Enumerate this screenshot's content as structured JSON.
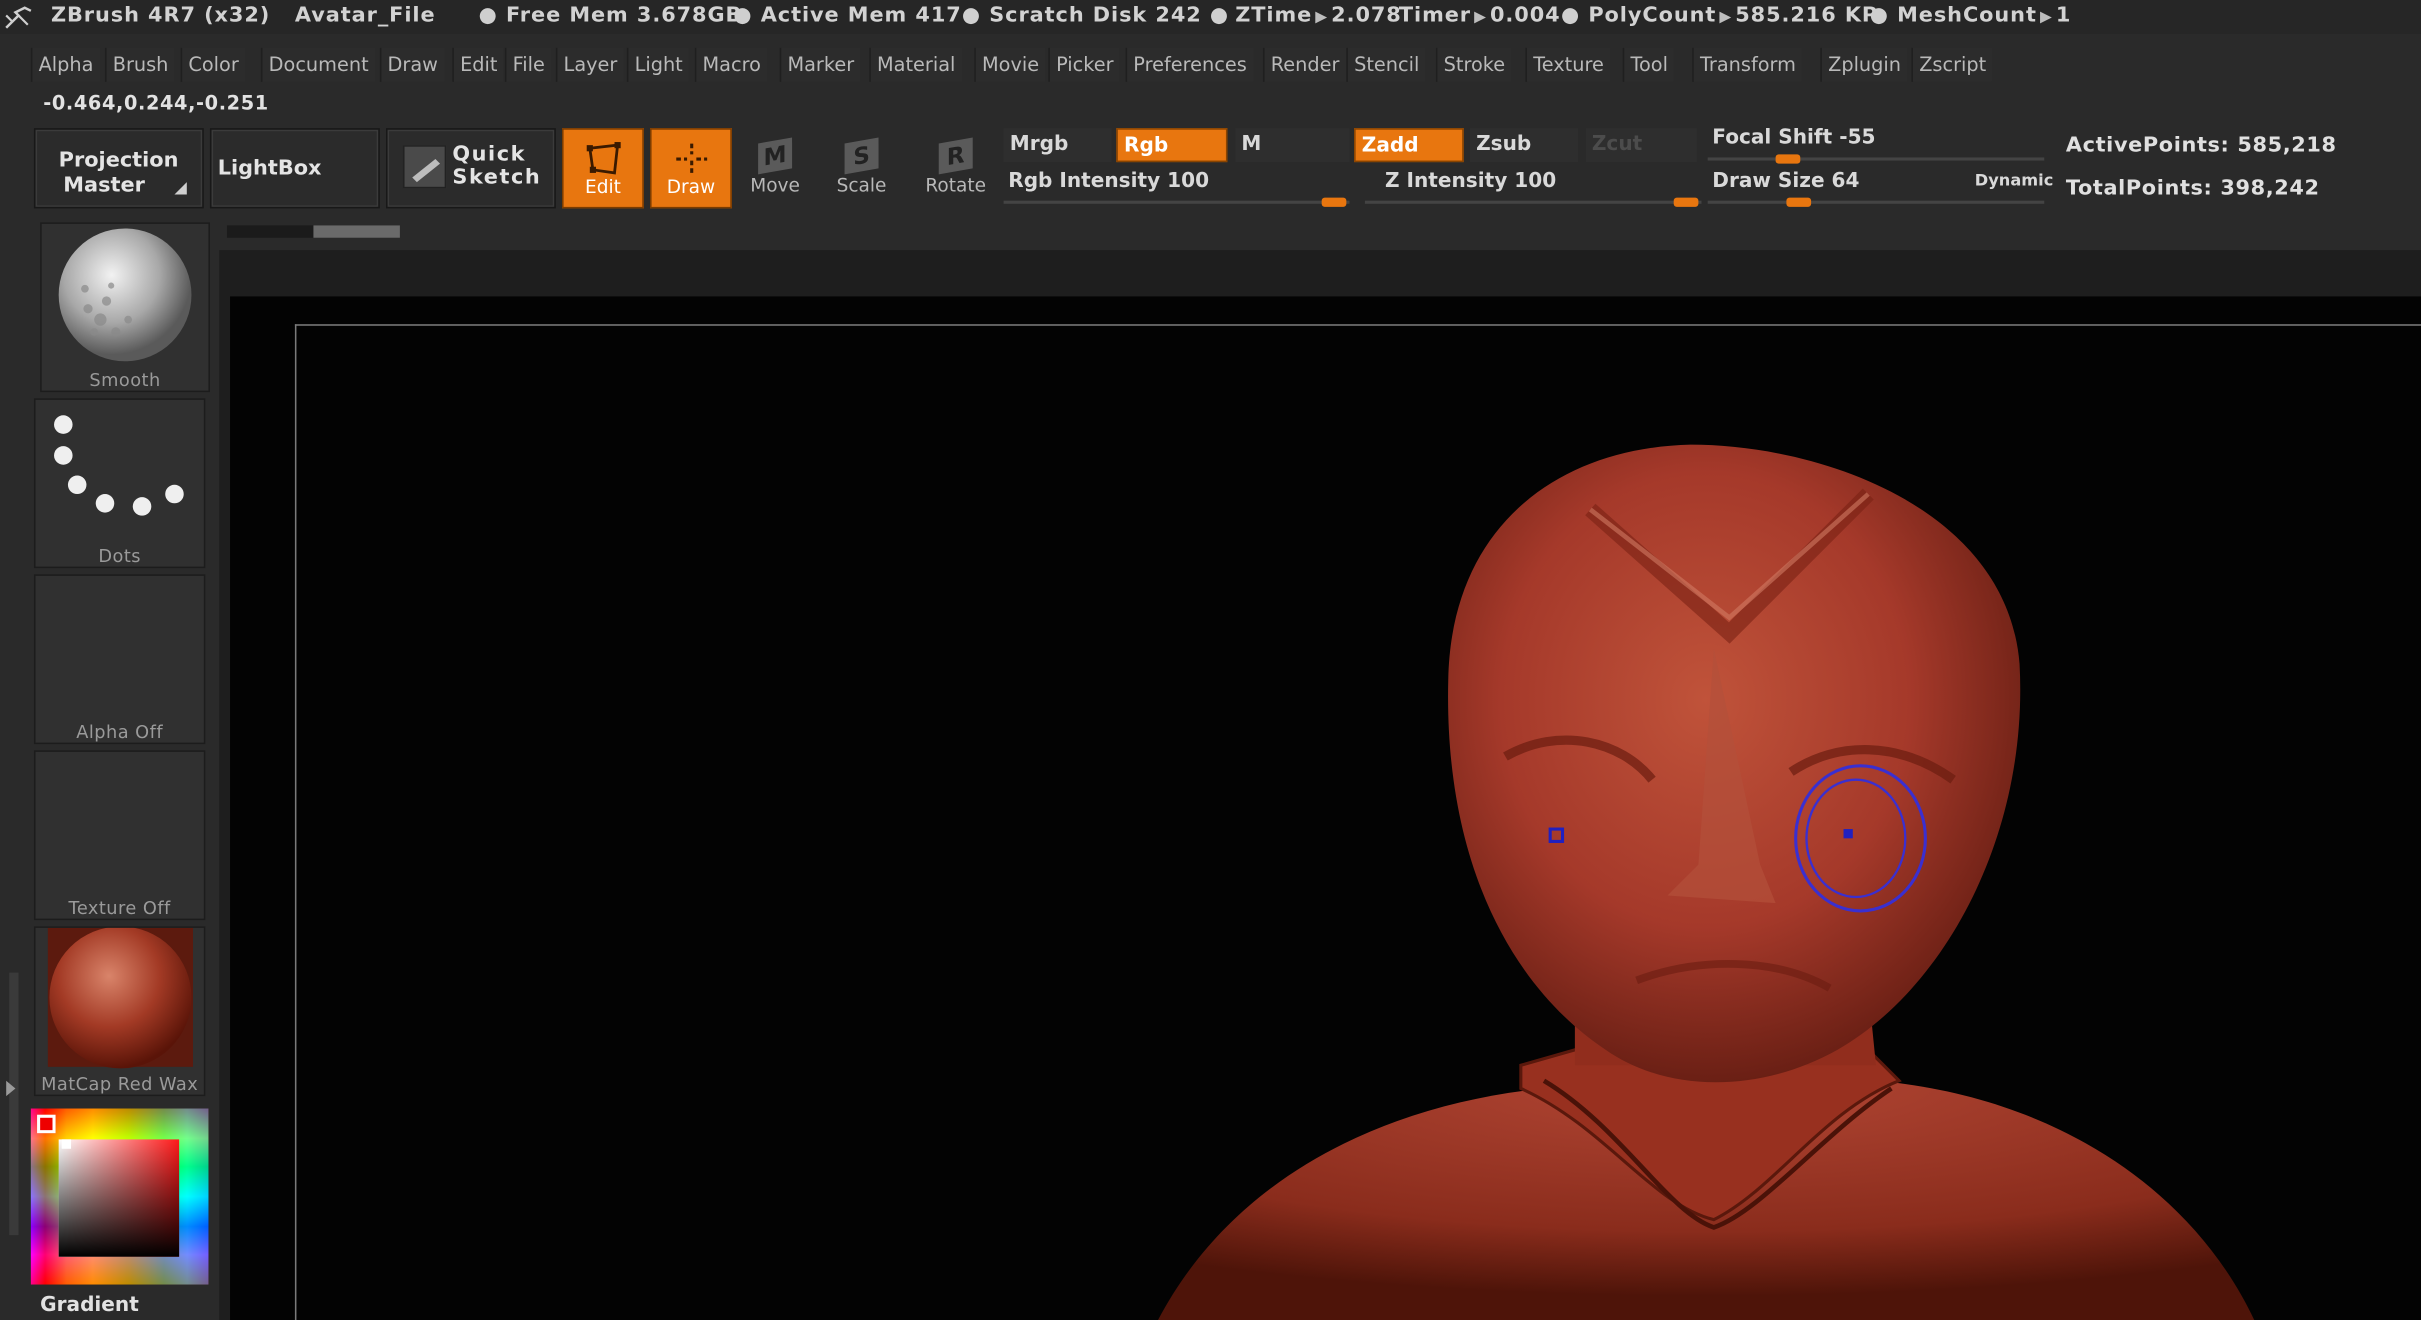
{
  "title_bar": {
    "app_name": "ZBrush 4R7 (x32)",
    "document_name": "Avatar_File",
    "free_mem_label": "Free Mem",
    "free_mem_value": "3.678GB",
    "active_mem_label": "Active Mem",
    "active_mem_value": "417",
    "scratch_disk_label": "Scratch Disk",
    "scratch_disk_value": "242",
    "ztime_label": "ZTime",
    "ztime_value": "2.078",
    "timer_label": "Timer",
    "timer_value": "0.004",
    "polycount_label": "PolyCount",
    "polycount_value": "585.216 KP",
    "meshcount_label": "MeshCount",
    "meshcount_value": "1",
    "logo_icon": "zbrush-logo-icon"
  },
  "menu": {
    "items": [
      "Alpha",
      "Brush",
      "Color",
      "Document",
      "Draw",
      "Edit",
      "File",
      "Layer",
      "Light",
      "Macro",
      "Marker",
      "Material",
      "Movie",
      "Picker",
      "Preferences",
      "Render",
      "Stencil",
      "Stroke",
      "Texture",
      "Tool",
      "Transform",
      "Zplugin",
      "Zscript"
    ]
  },
  "coordinates": "-0.464,0.244,-0.251",
  "shelf": {
    "projection_master_line1": "Projection",
    "projection_master_line2": "Master",
    "lightbox": "LightBox",
    "quick_sketch_line1": "Quick",
    "quick_sketch_line2": "Sketch",
    "edit": "Edit",
    "draw": "Draw",
    "move": "Move",
    "scale": "Scale",
    "rotate": "Rotate",
    "move_glyph": "M",
    "scale_glyph": "S",
    "rotate_glyph": "R",
    "mrgb": "Mrgb",
    "rgb": "Rgb",
    "m": "M",
    "zadd": "Zadd",
    "zsub": "Zsub",
    "zcut": "Zcut",
    "rgb_intensity_label": "Rgb  Intensity 100",
    "rgb_intensity_level": 100,
    "z_intensity_label": "Z  Intensity 100",
    "z_intensity_level": 100,
    "focal_shift_label": "Focal  Shift -55",
    "focal_shift_value": -55,
    "draw_size_label": "Draw  Size 64",
    "draw_size_value": 64,
    "dynamic": "Dynamic",
    "active_points": "ActivePoints: 585,218",
    "total_points": "TotalPoints: 398,242"
  },
  "left_tray": {
    "brush": "Smooth",
    "stroke": "Dots",
    "alpha": "Alpha  Off",
    "texture": "Texture  Off",
    "material": "MatCap  Red  Wax",
    "color_label": "Gradient"
  },
  "colors": {
    "accent_orange": "#e8760f",
    "clay_red": "#a53a26",
    "canvas_bg": "#030303",
    "cursor_ring": "#3a2fd0"
  }
}
